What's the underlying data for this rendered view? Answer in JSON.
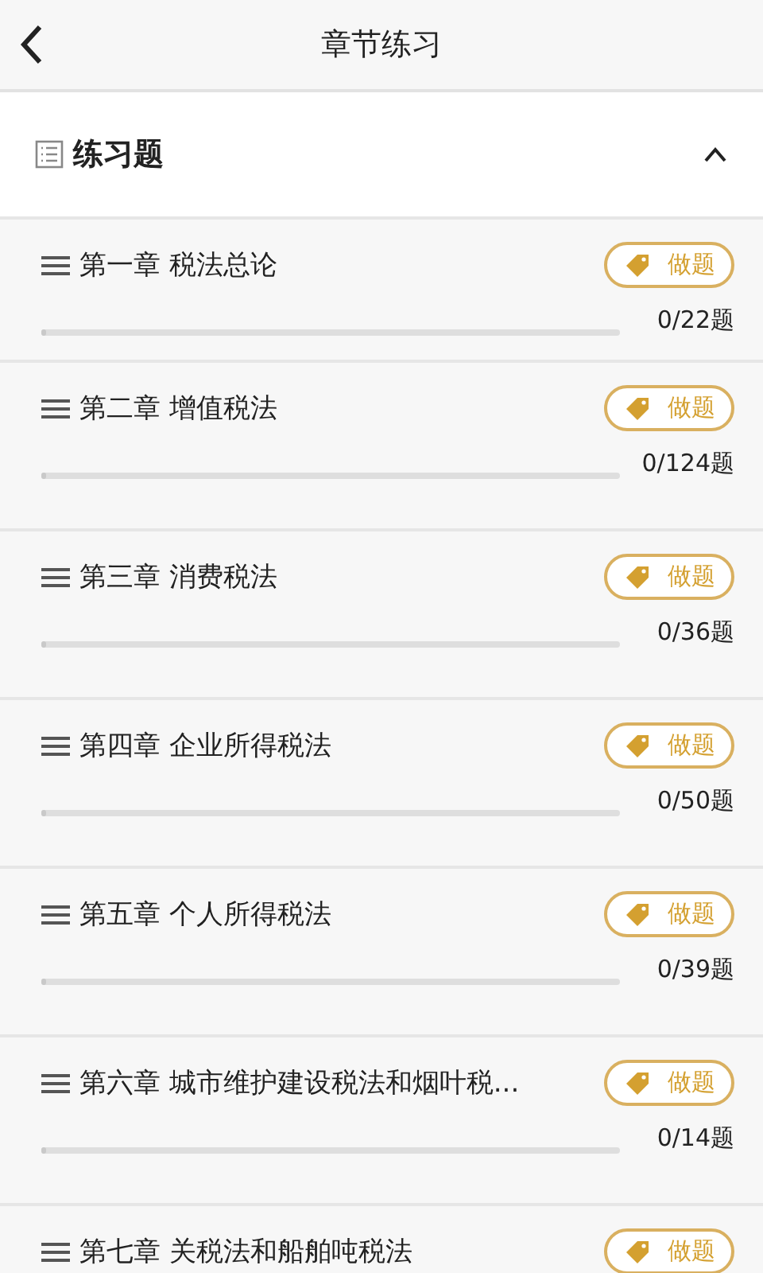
{
  "header": {
    "title": "章节练习"
  },
  "section": {
    "title": "练习题",
    "expanded": true
  },
  "chapters": [
    {
      "title": "第一章 税法总论",
      "action": "做题",
      "count": "0/22题",
      "level": 0
    },
    {
      "title": "第二章 增值税法",
      "action": "做题",
      "count": "0/124题",
      "level": 0
    },
    {
      "title": "第三章 消费税法",
      "action": "做题",
      "count": "0/36题",
      "level": 0
    },
    {
      "title": "第四章 企业所得税法",
      "action": "做题",
      "count": "0/50题",
      "level": 0
    },
    {
      "title": "第五章 个人所得税法",
      "action": "做题",
      "count": "0/39题",
      "level": 0
    },
    {
      "title": "第六章 城市维护建设税法和烟叶税...",
      "action": "做题",
      "count": "0/14题",
      "level": 0
    },
    {
      "title": "第七章 关税法和船舶吨税法",
      "action": "做题"
    }
  ]
}
